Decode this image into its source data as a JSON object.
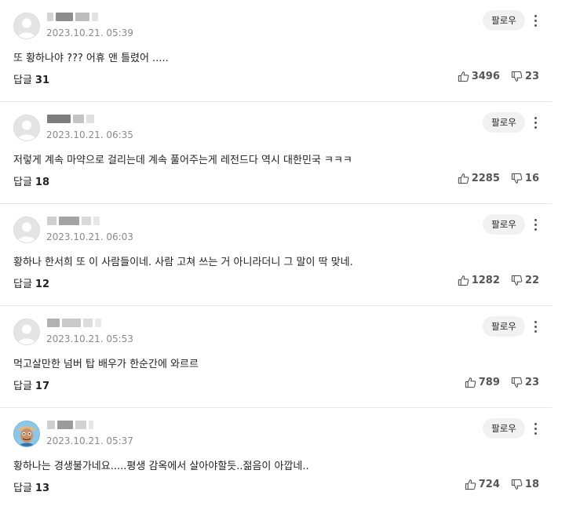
{
  "labels": {
    "follow": "팔로우",
    "reply": "답글"
  },
  "comments": [
    {
      "time": "2023.10.21. 05:39",
      "text": "또 황하나야 ??? 어휴 앤 틀렸어 .....",
      "replies": "31",
      "likes": "3496",
      "dislikes": "23",
      "avatar": "default"
    },
    {
      "time": "2023.10.21. 06:35",
      "text": "저렇게 계속 마약으로 걸리는데 계속 풀어주는게 레전드다 역시 대한민국 ㅋㅋㅋ",
      "replies": "18",
      "likes": "2285",
      "dislikes": "16",
      "avatar": "default"
    },
    {
      "time": "2023.10.21. 06:03",
      "text": "황하나 한서희 또 이 사람들이네. 사람 고쳐 쓰는 거 아니라더니 그 말이 딱 맞네.",
      "replies": "12",
      "likes": "1282",
      "dislikes": "22",
      "avatar": "default"
    },
    {
      "time": "2023.10.21. 05:53",
      "text": "먹고살만한 넘버 탑 배우가 한순간에 와르르",
      "replies": "17",
      "likes": "789",
      "dislikes": "23",
      "avatar": "default"
    },
    {
      "time": "2023.10.21. 05:37",
      "text": "황하나는 경생불가네요.....평생 감옥에서 살아야할듯..젊음이 아깝네..",
      "replies": "13",
      "likes": "724",
      "dislikes": "18",
      "avatar": "cartoon"
    }
  ]
}
